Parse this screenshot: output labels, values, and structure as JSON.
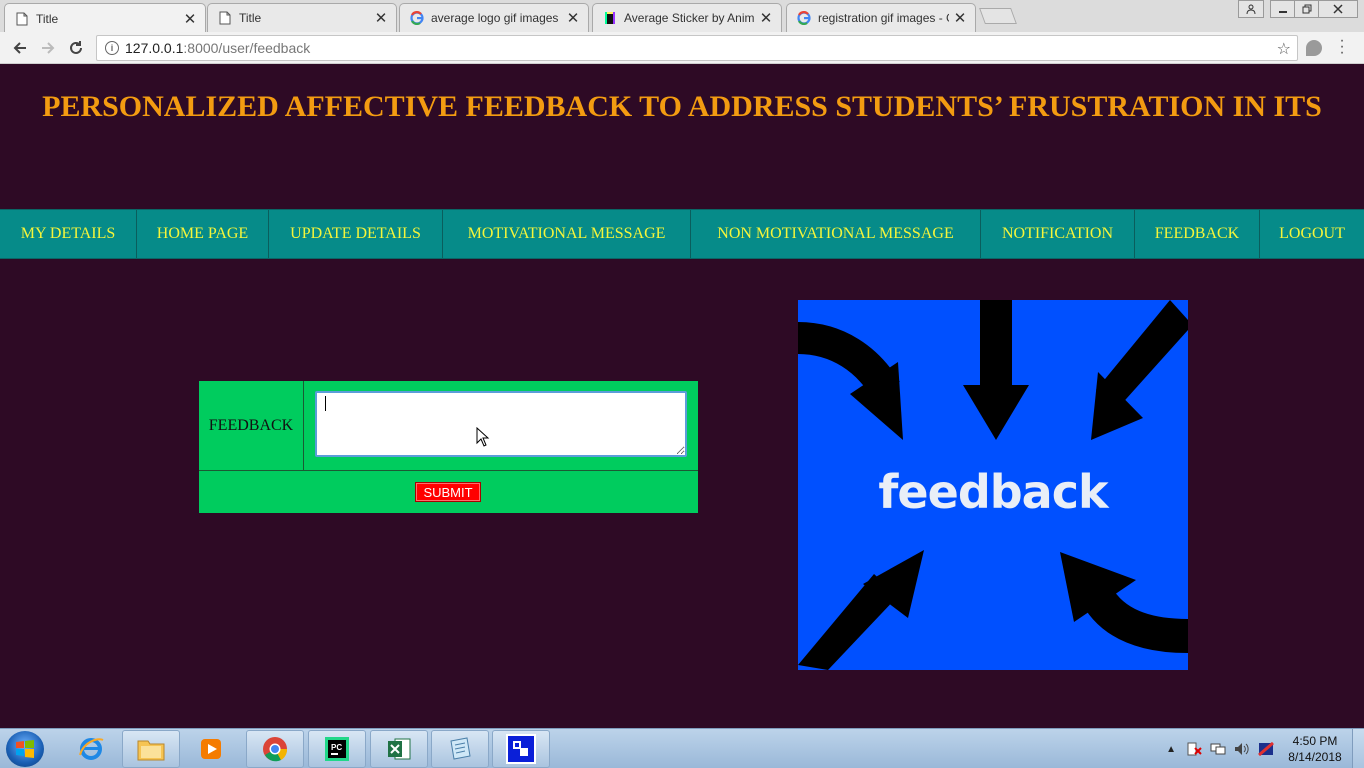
{
  "browser": {
    "tabs": [
      {
        "label": "Title",
        "icon": "page-icon",
        "active": true
      },
      {
        "label": "Title",
        "icon": "page-icon",
        "active": false
      },
      {
        "label": "average logo gif images",
        "icon": "google-icon",
        "active": false
      },
      {
        "label": "Average Sticker by Anima",
        "icon": "giphy-icon",
        "active": false
      },
      {
        "label": "registration gif images - G",
        "icon": "google-icon",
        "active": false
      }
    ],
    "url_host": "127.0.0.1",
    "url_path": ":8000/user/feedback"
  },
  "page": {
    "title": "PERSONALIZED AFFECTIVE FEEDBACK TO ADDRESS STUDENTS’ FRUSTRATION IN ITS",
    "nav": [
      "MY DETAILS",
      "HOME PAGE",
      "UPDATE DETAILS",
      "MOTIVATIONAL MESSAGE",
      "NON MOTIVATIONAL MESSAGE",
      "NOTIFICATION",
      "FEEDBACK",
      "LOGOUT"
    ],
    "form": {
      "label": "FEEDBACK",
      "value": "",
      "submit": "SUBMIT"
    },
    "image_text": "feedback"
  },
  "taskbar": {
    "apps": [
      "ie-icon",
      "explorer-icon",
      "media-player-icon",
      "chrome-icon",
      "pycharm-icon",
      "excel-icon",
      "notepad-icon",
      "remote-app-icon"
    ],
    "time": "4:50 PM",
    "date": "8/14/2018"
  },
  "colors": {
    "page_bg": "#2e0a25",
    "heading": "#f39c11",
    "nav_bg": "#068b89",
    "nav_text": "#f5f53a",
    "form_bg": "#00cc5e",
    "submit_bg": "#ff0000",
    "image_bg": "#0050ff"
  }
}
